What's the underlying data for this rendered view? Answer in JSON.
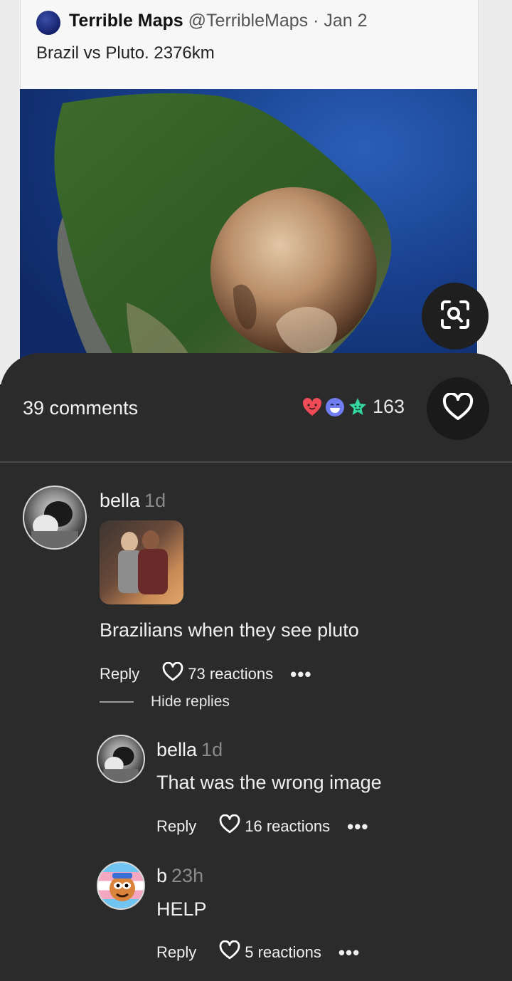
{
  "tweet": {
    "author_name": "Terrible Maps",
    "author_handle": "@TerribleMaps",
    "separator": "·",
    "date": "Jan 2",
    "text": "Brazil vs Pluto.  2376km"
  },
  "pin": {
    "lens_icon": "visual-search-icon"
  },
  "comments_header": {
    "count_label": "39 comments",
    "reaction_icons": [
      "heart-face-icon",
      "laughing-face-icon",
      "star-face-icon"
    ],
    "reaction_total": "163",
    "like_icon": "heart-outline-icon"
  },
  "comments": [
    {
      "name": "bella",
      "time": "1d",
      "text": "Brazilians when they see pluto",
      "reply_label": "Reply",
      "reactions_label": "73 reactions",
      "more_label": "•••",
      "hide_replies_label": "Hide replies"
    },
    {
      "name": "bella",
      "time": "1d",
      "text": "That was the wrong image",
      "reply_label": "Reply",
      "reactions_label": "16 reactions",
      "more_label": "•••"
    },
    {
      "name": "b",
      "time": "23h",
      "text": "HELP",
      "reply_label": "Reply",
      "reactions_label": "5 reactions",
      "more_label": "•••"
    }
  ],
  "colors": {
    "panel_bg": "#2b2b2b",
    "heart_red": "#ef4b57",
    "laugh_blue": "#6f7cf2",
    "star_green": "#35d6a2"
  }
}
